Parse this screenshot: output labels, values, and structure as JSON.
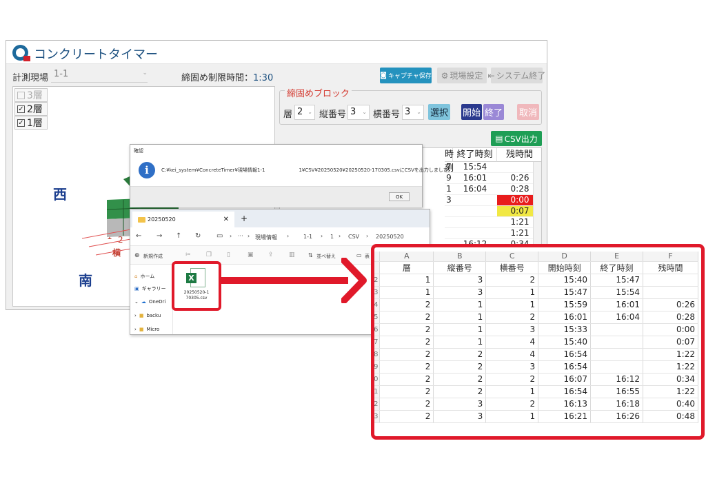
{
  "app": {
    "title": "コンクリートタイマー",
    "site_label": "計測現場",
    "site_value": "1-1",
    "limit_label": "締固め制限時間：",
    "limit_value": "1:30",
    "buttons": {
      "capture": "キャプチャ保存",
      "site_settings": "現場設定",
      "system_exit": "システム終了",
      "csv": "CSV出力"
    },
    "layers": [
      {
        "label": "3層",
        "checked": false,
        "enabled": false
      },
      {
        "label": "2層",
        "checked": true,
        "enabled": true
      },
      {
        "label": "1層",
        "checked": true,
        "enabled": true
      }
    ],
    "compass": {
      "west": "西",
      "south": "南",
      "horizontal": "横"
    },
    "axis_numbers": [
      "1",
      "2"
    ],
    "block_group": {
      "legend": "締固めブロック",
      "layer_label": "層",
      "layer_value": "2",
      "vertical_label": "縦番号",
      "vertical_value": "3",
      "horizontal_label": "横番号",
      "horizontal_value": "3",
      "select": "選択",
      "start": "開始",
      "end": "終了",
      "cancel": "取消"
    },
    "table": {
      "headers": {
        "start_partial": "時刻",
        "end": "終了時刻",
        "remaining": "残時間"
      },
      "rows": [
        {
          "start_partial": "7",
          "end": "15:54",
          "remaining": ""
        },
        {
          "start_partial": "9",
          "end": "16:01",
          "remaining": "0:26"
        },
        {
          "start_partial": "1",
          "end": "16:04",
          "remaining": "0:28"
        },
        {
          "start_partial": "3",
          "end": "",
          "remaining": "0:00"
        },
        {
          "start_partial": "",
          "end": "",
          "remaining": "0:07"
        },
        {
          "start_partial": "",
          "end": "",
          "remaining": "1:21"
        },
        {
          "start_partial": "",
          "end": "",
          "remaining": "1:21"
        },
        {
          "start_partial": "",
          "end": "16:12",
          "remaining": "0:34"
        }
      ]
    }
  },
  "dialog": {
    "title": "確認",
    "message": "C:¥kei_system¥ConcreteTimer¥現場情報1-1　　　　　　　1¥CSV¥20250520¥20250520-170305.csvにCSVを出力しました。",
    "ok": "OK"
  },
  "explorer": {
    "tab_title": "20250520",
    "path": [
      "現場情報",
      "1-1",
      "1",
      "CSV",
      "20250520"
    ],
    "new_label": "新規作成",
    "sort_label": "並べ替え",
    "view_label": "表",
    "nav": [
      "ホーム",
      "ギャラリー",
      "OneDri",
      "backu",
      "Micro"
    ],
    "file_name": "20250520-170305.csv",
    "file_name_line1": "20250520-1",
    "file_name_line2": "70305.csv"
  },
  "sheet": {
    "columns": [
      "A",
      "B",
      "C",
      "D",
      "E",
      "F"
    ],
    "headers": [
      "層",
      "縦番号",
      "横番号",
      "開始時刻",
      "終了時刻",
      "残時間"
    ],
    "row_numbers": [
      "2",
      "3",
      "4",
      "5",
      "6",
      "7",
      "8",
      "9",
      "0",
      "1",
      "2",
      "3"
    ],
    "rows": [
      [
        "1",
        "3",
        "2",
        "15:40",
        "15:47",
        ""
      ],
      [
        "1",
        "3",
        "1",
        "15:47",
        "15:54",
        ""
      ],
      [
        "2",
        "1",
        "1",
        "15:59",
        "16:01",
        "0:26"
      ],
      [
        "2",
        "1",
        "2",
        "16:01",
        "16:04",
        "0:28"
      ],
      [
        "2",
        "1",
        "3",
        "15:33",
        "",
        "0:00"
      ],
      [
        "2",
        "1",
        "4",
        "15:40",
        "",
        "0:07"
      ],
      [
        "2",
        "2",
        "4",
        "16:54",
        "",
        "1:22"
      ],
      [
        "2",
        "2",
        "3",
        "16:54",
        "",
        "1:22"
      ],
      [
        "2",
        "2",
        "2",
        "16:07",
        "16:12",
        "0:34"
      ],
      [
        "2",
        "2",
        "1",
        "16:54",
        "16:55",
        "1:22"
      ],
      [
        "2",
        "3",
        "2",
        "16:13",
        "16:18",
        "0:40"
      ],
      [
        "2",
        "3",
        "1",
        "16:21",
        "16:26",
        "0:48"
      ]
    ]
  },
  "colors": {
    "accent_red": "#e0192a",
    "alert_red": "#e81c1c",
    "warn_yellow": "#f1e843",
    "title_blue": "#1b4f7f"
  }
}
